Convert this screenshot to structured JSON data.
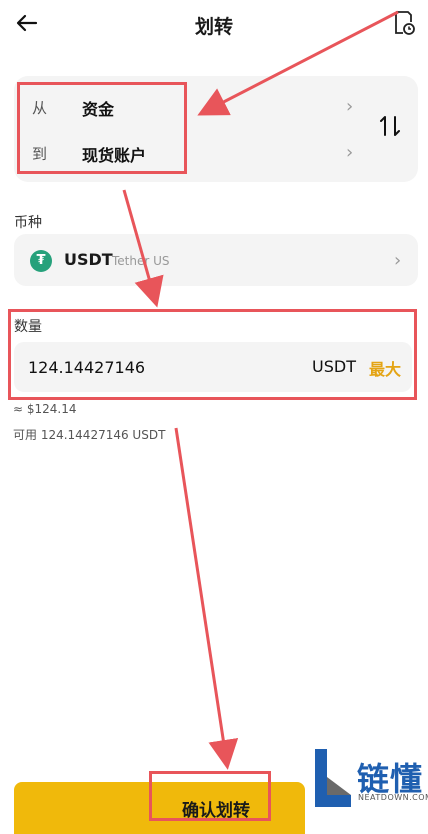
{
  "header": {
    "title": "划转",
    "back_icon": "arrow-left-icon",
    "history_icon": "history-icon"
  },
  "transfer": {
    "from": {
      "label": "从",
      "value": "资金"
    },
    "to": {
      "label": "到",
      "value": "现货账户"
    },
    "swap_icon": "swap-icon"
  },
  "coin": {
    "section_label": "币种",
    "symbol": "USDT",
    "name": "Tether US",
    "logo_color": "#26a17b"
  },
  "amount": {
    "section_label": "数量",
    "value": "124.14427146",
    "unit": "USDT",
    "max_label": "最大",
    "usd_estimate": "≈ $124.14",
    "available": "可用 124.14427146 USDT"
  },
  "confirm": {
    "label": "确认划转"
  },
  "colors": {
    "accent": "#f0b90b",
    "max_text": "#e4a414",
    "annotation": "#e8555a"
  },
  "watermark": {
    "name": "链懂",
    "site": "NEATDOWN.COM"
  }
}
